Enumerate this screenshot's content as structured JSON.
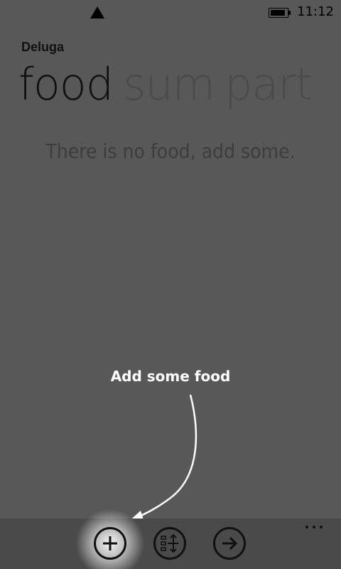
{
  "status_bar": {
    "time": "11:12",
    "icons": [
      "signal-icon",
      "battery-icon"
    ]
  },
  "app": {
    "title": "Deluga"
  },
  "pivot": {
    "items": [
      "food",
      "sum",
      "part"
    ],
    "active_index": 0
  },
  "content": {
    "empty_message": "There is no food, add some."
  },
  "tutorial": {
    "callout_text": "Add some food"
  },
  "app_bar": {
    "buttons": [
      {
        "icon": "add-icon"
      },
      {
        "icon": "sort-icon"
      },
      {
        "icon": "arrow-right-icon"
      }
    ],
    "more": "more-icon"
  },
  "colors": {
    "background": "#585858",
    "app_bar": "#4a4a4a",
    "active_text": "#111111",
    "inactive_text": "#4a4a4a",
    "callout_text": "#ffffff"
  }
}
